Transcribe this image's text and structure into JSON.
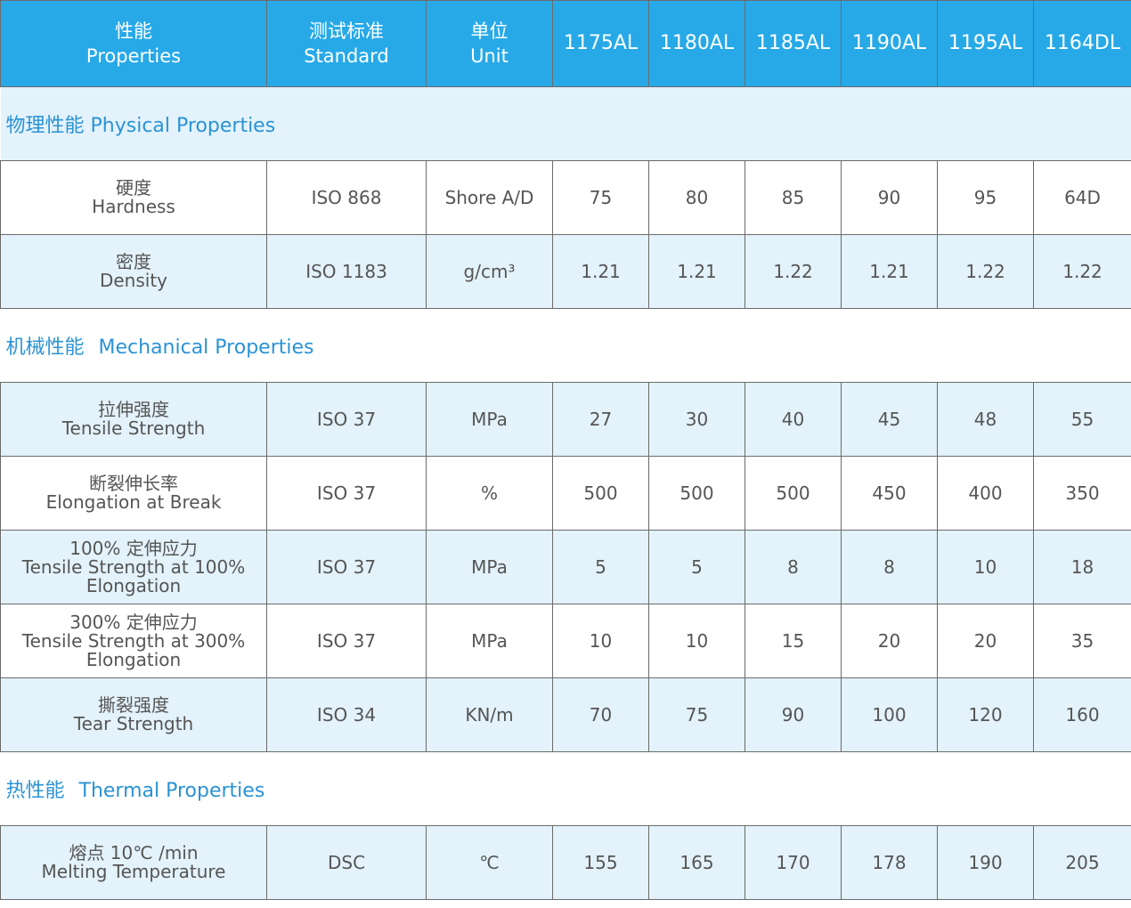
{
  "header": {
    "prop_cn": "性能",
    "prop_en": "Properties",
    "std_cn": "测试标准",
    "std_en": "Standard",
    "unit_cn": "单位",
    "unit_en": "Unit",
    "grades": [
      "1175AL",
      "1180AL",
      "1185AL",
      "1190AL",
      "1195AL",
      "1164DL"
    ]
  },
  "sections": {
    "physical": {
      "cn": "物理性能",
      "en": "Physical Properties"
    },
    "mechanical": {
      "cn": "机械性能",
      "en": "Mechanical Properties"
    },
    "thermal": {
      "cn": "热性能",
      "en": "Thermal Properties"
    }
  },
  "rows": [
    {
      "cn": "硬度",
      "en": "Hardness",
      "standard": "ISO 868",
      "unit": "Shore A/D",
      "values": [
        "75",
        "80",
        "85",
        "90",
        "95",
        "64D"
      ]
    },
    {
      "cn": "密度",
      "en": "Density",
      "standard": "ISO 1183",
      "unit": "g/cm³",
      "values": [
        "1.21",
        "1.21",
        "1.22",
        "1.21",
        "1.22",
        "1.22"
      ]
    },
    {
      "cn": "拉伸强度",
      "en": "Tensile Strength",
      "standard": "ISO 37",
      "unit": "MPa",
      "values": [
        "27",
        "30",
        "40",
        "45",
        "48",
        "55"
      ]
    },
    {
      "cn": "断裂伸长率",
      "en": "Elongation at Break",
      "standard": "ISO 37",
      "unit": "%",
      "values": [
        "500",
        "500",
        "500",
        "450",
        "400",
        "350"
      ]
    },
    {
      "cn": "100% 定伸应力",
      "en": "Tensile Strength at 100%",
      "en2": "Elongation",
      "standard": "ISO 37",
      "unit": "MPa",
      "values": [
        "5",
        "5",
        "8",
        "8",
        "10",
        "18"
      ]
    },
    {
      "cn": "300% 定伸应力",
      "en": "Tensile Strength at 300%",
      "en2": "Elongation",
      "standard": "ISO 37",
      "unit": "MPa",
      "values": [
        "10",
        "10",
        "15",
        "20",
        "20",
        "35"
      ]
    },
    {
      "cn": "撕裂强度",
      "en": "Tear Strength",
      "standard": "ISO 34",
      "unit": "KN/m",
      "values": [
        "70",
        "75",
        "90",
        "100",
        "120",
        "160"
      ]
    },
    {
      "cn": "熔点 10℃ /min",
      "en": "Melting Temperature",
      "standard": "DSC",
      "unit": "℃",
      "values": [
        "155",
        "165",
        "170",
        "178",
        "190",
        "205"
      ]
    }
  ]
}
